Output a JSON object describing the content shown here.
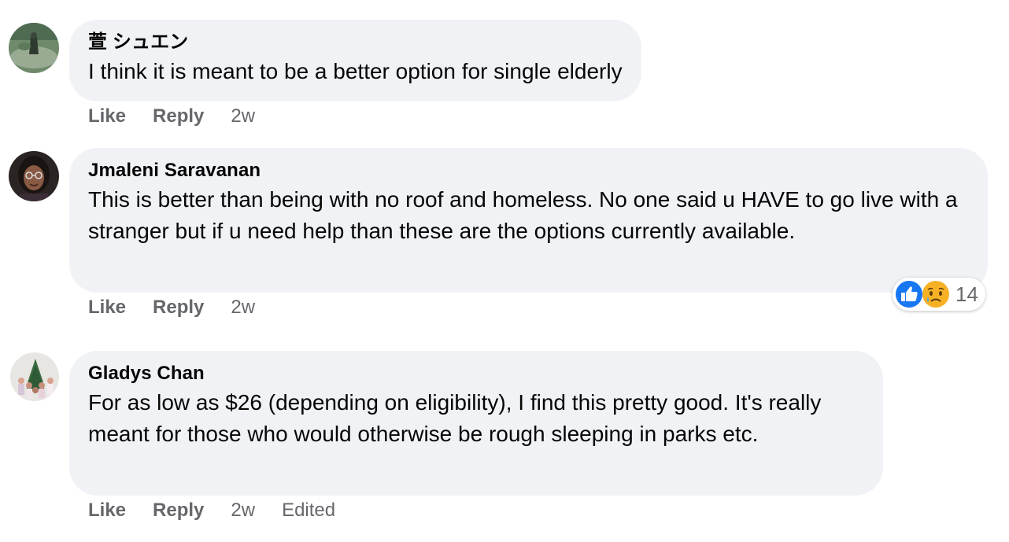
{
  "comments": [
    {
      "author": "萱 シュエン",
      "text": "I think it is meant to be a better option for single elderly",
      "like_label": "Like",
      "reply_label": "Reply",
      "time": "2w"
    },
    {
      "author": "Jmaleni Saravanan",
      "text": "This is better than being with no roof and homeless. No one said u HAVE to go live with a stranger but if u need help than these are the options currently available.",
      "like_label": "Like",
      "reply_label": "Reply",
      "time": "2w",
      "reactions": {
        "icons": [
          "like-icon",
          "sad-icon"
        ],
        "count": "14"
      }
    },
    {
      "author": "Gladys Chan",
      "text": "For as low as $26 (depending on eligibility), I find this pretty good. It's really meant for those who would otherwise be rough sleeping in parks etc.",
      "like_label": "Like",
      "reply_label": "Reply",
      "time": "2w",
      "edited": "Edited"
    }
  ],
  "colors": {
    "bubble": "#f0f2f5",
    "secondary_text": "#65676b",
    "like_blue": "#1877f2",
    "sad_yellow": "#f7b125"
  }
}
